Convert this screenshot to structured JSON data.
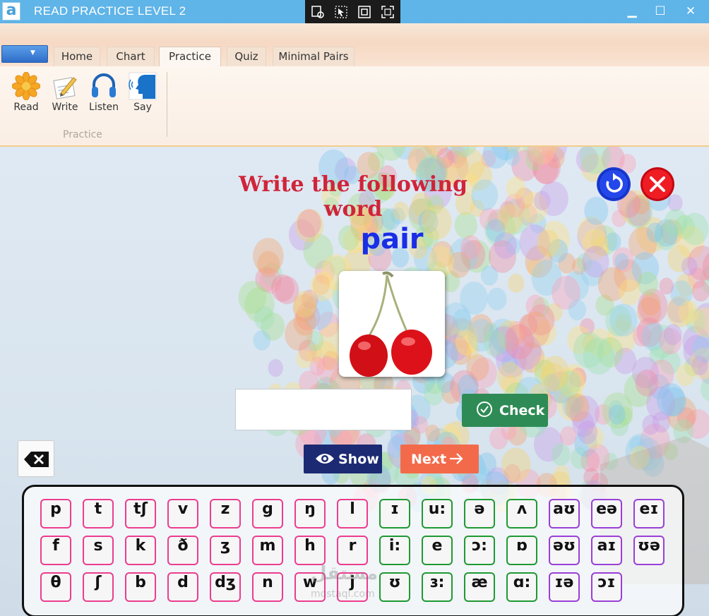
{
  "window": {
    "title": "READ PRACTICE LEVEL 2",
    "app_icon": "a",
    "minimize": "▁",
    "maximize": "☐",
    "close": "✕"
  },
  "ribbon": {
    "tabs": [
      {
        "label": "Home"
      },
      {
        "label": "Chart"
      },
      {
        "label": "Practice"
      },
      {
        "label": "Quiz"
      },
      {
        "label": "Minimal Pairs"
      }
    ],
    "active_tab": "Practice",
    "buttons": [
      {
        "label": "Read",
        "icon": "flower-icon"
      },
      {
        "label": "Write",
        "icon": "notepad-pencil-icon"
      },
      {
        "label": "Listen",
        "icon": "headphones-icon"
      },
      {
        "label": "Say",
        "icon": "speaking-head-icon"
      }
    ],
    "group_label": "Practice"
  },
  "exercise": {
    "instruction": "Write the following word",
    "word": "pair",
    "picture": "cherries-image",
    "answer_value": "",
    "check_label": "Check",
    "show_label": "Show",
    "next_label": "Next"
  },
  "keyboard": {
    "rows": [
      [
        "p",
        "t",
        "tʃ",
        "v",
        "z",
        "g",
        "ŋ",
        "l",
        "ɪ",
        "u:",
        "ə",
        "ʌ",
        "aʊ",
        "eə",
        "eɪ"
      ],
      [
        "f",
        "s",
        "k",
        "ð",
        "ʒ",
        "m",
        "h",
        "r",
        "i:",
        "e",
        "ɔ:",
        "ɒ",
        "əʊ",
        "aɪ",
        "ʊə"
      ],
      [
        "θ",
        "ʃ",
        "b",
        "d",
        "dʒ",
        "n",
        "w",
        "j",
        "ʊ",
        "ɜ:",
        "æ",
        "ɑ:",
        "ɪə",
        "ɔɪ"
      ]
    ],
    "groups": {
      "consonant_color": "#ec3d8f",
      "vowel_color": "#1e9a33",
      "diphthong_color": "#9a3fd8"
    }
  },
  "watermark": {
    "text": "مستقل",
    "sub": "mostaql.com"
  },
  "colors": {
    "titlebar": "#5fb4e8",
    "instruction": "#d0243a",
    "word": "#1a2ee6",
    "check": "#2e8b55",
    "show": "#1c2a74",
    "next": "#f36a4b"
  }
}
